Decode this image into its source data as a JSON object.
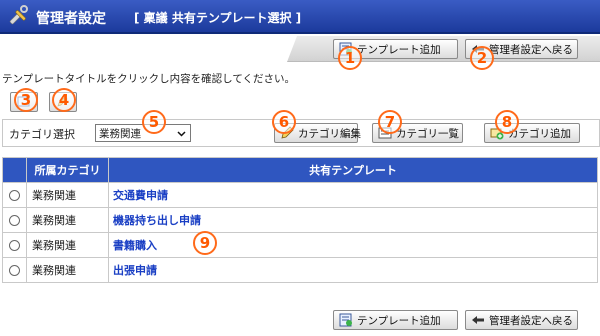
{
  "header": {
    "title": "管理者設定",
    "subtitle": "[ 稟議 共有テンプレート選択 ]",
    "icon": "tools-icon",
    "bg_color": "#2a4bb3"
  },
  "toolbar": {
    "add_template_label": "テンプレート追加",
    "back_label": "管理者設定へ戻る"
  },
  "instruction": "テンプレートタイトルをクリックし内容を確認してください。",
  "category": {
    "label": "カテゴリ選択",
    "selected": "業務関連",
    "edit_label": "カテゴリ編集",
    "list_label": "カテゴリ一覧",
    "add_label": "カテゴリ追加"
  },
  "table": {
    "headers": [
      "所属カテゴリ",
      "共有テンプレート"
    ],
    "rows": [
      {
        "category": "業務関連",
        "template": "交通費申請"
      },
      {
        "category": "業務関連",
        "template": "機器持ち出し申請"
      },
      {
        "category": "業務関連",
        "template": "書籍購入"
      },
      {
        "category": "業務関連",
        "template": "出張申請"
      }
    ]
  },
  "callouts": [
    "1",
    "2",
    "3",
    "4",
    "5",
    "6",
    "7",
    "8",
    "9"
  ],
  "colors": {
    "header_blue": "#2f56c0",
    "callout_orange": "#ff6a1a",
    "link_blue": "#1a3fc4"
  }
}
